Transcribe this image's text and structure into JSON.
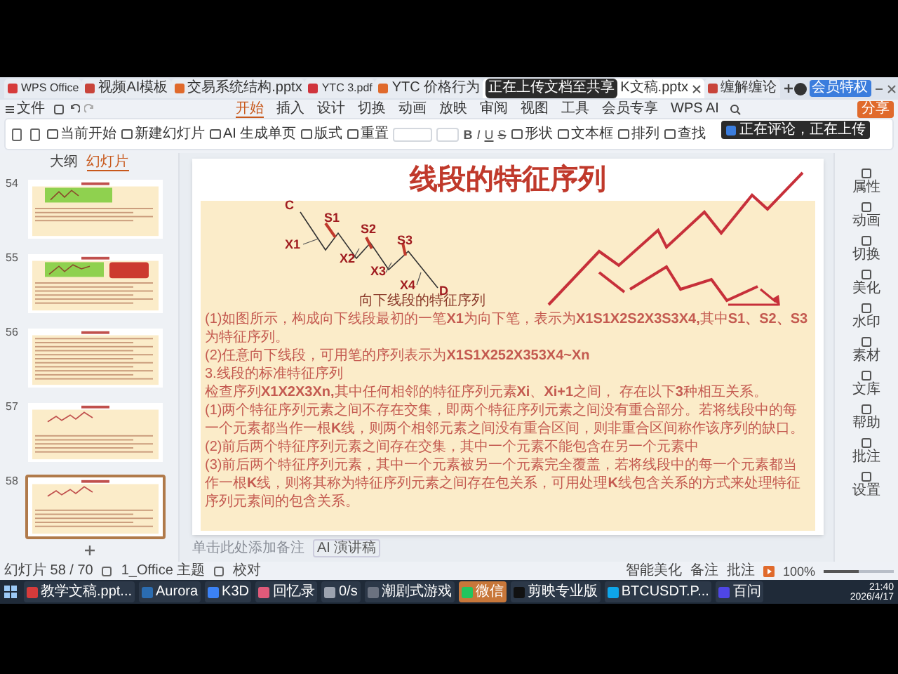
{
  "doc_tabs": [
    {
      "label": "WPS Office",
      "kind": "wps",
      "selected": false
    },
    {
      "label": "视频AI模板",
      "kind": "doc",
      "selected": false
    },
    {
      "label": "交易系统结构.pptx",
      "kind": "ppt",
      "selected": false
    },
    {
      "label": "YTC 3.pdf",
      "kind": "pdf",
      "selected": false
    },
    {
      "label": "YTC 价格行为",
      "kind": "ppt",
      "selected": false
    },
    {
      "label": "K文稿.pptx",
      "kind": "ppt",
      "selected": true
    },
    {
      "label": "缠解缠论",
      "kind": "doc",
      "selected": false
    }
  ],
  "upload_toast": "正在上传文档至共享",
  "vip_button": "会员特权",
  "menu": {
    "file": "文件",
    "share": "分享",
    "tabs": [
      {
        "label": "开始",
        "selected": true
      },
      {
        "label": "插入",
        "selected": false
      },
      {
        "label": "设计",
        "selected": false
      },
      {
        "label": "切换",
        "selected": false
      },
      {
        "label": "动画",
        "selected": false
      },
      {
        "label": "放映",
        "selected": false
      },
      {
        "label": "审阅",
        "selected": false
      },
      {
        "label": "视图",
        "selected": false
      },
      {
        "label": "工具",
        "selected": false
      },
      {
        "label": "会员专享",
        "selected": false
      },
      {
        "label": "WPS AI",
        "selected": false
      }
    ]
  },
  "ribbon": {
    "buttons_left": [
      "当前开始",
      "新建幻灯片",
      "AI 生成单页",
      "版式",
      "重置"
    ],
    "format_buttons": [
      "B",
      "I",
      "U",
      "S"
    ],
    "buttons_right": [
      "形状",
      "文本框",
      "排列",
      "查找"
    ]
  },
  "comment_toast": "正在评论，正在上传",
  "panel": {
    "tabs": [
      {
        "label": "大纲",
        "selected": false
      },
      {
        "label": "幻灯片",
        "selected": true
      }
    ],
    "thumbnails": [
      {
        "number": "54",
        "kind": "green-chart",
        "selected": false
      },
      {
        "number": "55",
        "kind": "green-red",
        "selected": false
      },
      {
        "number": "56",
        "kind": "text",
        "selected": false
      },
      {
        "number": "57",
        "kind": "zigzag",
        "selected": false
      },
      {
        "number": "58",
        "kind": "zigzag",
        "selected": true
      }
    ]
  },
  "slide": {
    "title": "线段的特征序列",
    "diagram": {
      "labels": [
        "C",
        "S1",
        "S2",
        "S3",
        "X1",
        "X2",
        "X3",
        "X4",
        "D"
      ],
      "caption": "向下线段的特征序列"
    },
    "paragraphs": [
      "(1)如图所示，构成向下线段最初的一笔**X1**为向下笔，表示为**X1S1X2S2X3S3X4,**其中**S1、S2、S3**为特征序列。",
      "(2)任意向下线段，可用笔的序列表示为**X1S1X252X353X4~Xn**",
      "3.线段的标准特征序列",
      "检查序列**X1X2X3Xn,**其中任何相邻的特征序列元素**Xi**、**Xi+1**之间， 存在以下**3**种相互关系。",
      "(1)两个特征序列元素之间不存在交集，即两个特征序列元素之间没有重合部分。若将线段中的每一个元素都当作一根**K**线，则两个相邻元素之间没有重合区间，则非重合区间称作该序列的缺口。",
      "(2)前后两个特征序列元素之间存在交集，其中一个元素不能包含在另一个元素中",
      "(3)前后两个特征序列元素，其中一个元素被另一个元素完全覆盖，若将线段中的每一个元素都当作一根**K**线，则将其称为特征序列元素之间存在包关系，可用处理**K**线包含关系的方式来处理特征序列元素间的包含关系。"
    ]
  },
  "notes": {
    "placeholder": "单击此处添加备注",
    "ai_button": "AI 演讲稿"
  },
  "sidebar": [
    "属性",
    "动画",
    "切换",
    "美化",
    "水印",
    "素材",
    "文库",
    "帮助",
    "批注",
    "设置"
  ],
  "status_bar": {
    "slide_count": "幻灯片 58 / 70",
    "theme": "1_Office 主题",
    "proofread": "校对",
    "beautify": "智能美化",
    "notes": "备注",
    "comments": "批注",
    "zoom": "100%",
    "zoom_slider": {
      "level": 0.5
    }
  },
  "taskbar": {
    "items": [
      {
        "label": "教学文稿.ppt...",
        "color": "#d63b3b",
        "selected": false
      },
      {
        "label": "Aurora",
        "color": "#2b6cb0",
        "selected": false
      },
      {
        "label": "K3D",
        "color": "#3b82f6",
        "selected": false
      },
      {
        "label": "回忆录",
        "color": "#e05a7a",
        "selected": false
      },
      {
        "label": "0/s",
        "color": "#9ca3af",
        "selected": false
      },
      {
        "label": "潮剧式游戏",
        "color": "#6b7280",
        "selected": false
      },
      {
        "label": "微信",
        "color": "#22c55e",
        "selected": true
      },
      {
        "label": "剪映专业版",
        "color": "#111111",
        "selected": false
      },
      {
        "label": "BTCUSDT.P...",
        "color": "#0ea5e9",
        "selected": false
      },
      {
        "label": "百问",
        "color": "#4f46e5",
        "selected": false
      }
    ],
    "time": "21:40",
    "date": "2026/4/17"
  }
}
